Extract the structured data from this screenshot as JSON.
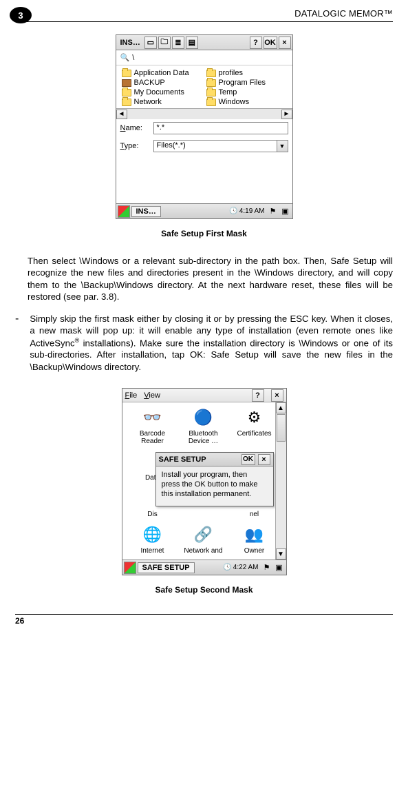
{
  "header": {
    "title": "DATALOGIC MEMOR™",
    "chapter": "3"
  },
  "screenshot1": {
    "titlebar": {
      "title": "INS…",
      "help": "?",
      "ok": "OK",
      "close": "×"
    },
    "path": "\\",
    "items_left": [
      {
        "label": "Application Data",
        "type": "folder"
      },
      {
        "label": "BACKUP",
        "type": "briefcase"
      },
      {
        "label": "My Documents",
        "type": "folder"
      },
      {
        "label": "Network",
        "type": "folder"
      }
    ],
    "items_right": [
      {
        "label": "profiles",
        "type": "folder"
      },
      {
        "label": "Program Files",
        "type": "folder"
      },
      {
        "label": "Temp",
        "type": "folder"
      },
      {
        "label": "Windows",
        "type": "folder"
      }
    ],
    "name_label": "Name:",
    "name_value": "*.*",
    "type_label": "Type:",
    "type_value": "Files(*.*)",
    "task_label": "INS…",
    "clock": "4:19 AM"
  },
  "caption1": "Safe Setup First Mask",
  "para1": "Then select \\Windows or a relevant sub-directory in the path box. Then, Safe Setup will recognize the new files and directories present in the \\Windows directory, and will copy them to the \\Backup\\Windows directory. At the next hardware reset, these files will be restored (see par. 3.8).",
  "bullet1": "Simply skip the first mask either by closing it or by pressing the ESC key. When it closes, a new mask will pop up: it will enable any type of installation (even remote ones like ActiveSync® installations). Make sure the installation directory is \\Windows or one of its sub-directories. After installation, tap OK: Safe Setup will save the new files in the \\Backup\\Windows directory.",
  "screenshot2": {
    "menu": {
      "file": "File",
      "view": "View",
      "help": "?",
      "close": "×"
    },
    "icons": [
      {
        "label": "Barcode Reader",
        "glyph": "👓"
      },
      {
        "label": "Bluetooth Device …",
        "glyph": "🔵"
      },
      {
        "label": "Certificates",
        "glyph": "⚙"
      },
      {
        "label": "Date",
        "glyph": ""
      },
      {
        "label": "",
        "glyph": ""
      },
      {
        "label": "",
        "glyph": ""
      },
      {
        "label": "Dis",
        "glyph": ""
      },
      {
        "label": "",
        "glyph": ""
      },
      {
        "label": "nel",
        "glyph": ""
      },
      {
        "label": "Internet",
        "glyph": "🌐"
      },
      {
        "label": "Network and",
        "glyph": "🔗"
      },
      {
        "label": "Owner",
        "glyph": "👥"
      }
    ],
    "dialog": {
      "title": "SAFE SETUP",
      "ok": "OK",
      "close": "×",
      "body": "Install your program, then press the OK button to make this installation permanent."
    },
    "task_label": "SAFE SETUP",
    "clock": "4:22 AM"
  },
  "caption2": "Safe Setup Second Mask",
  "page_number": "26"
}
